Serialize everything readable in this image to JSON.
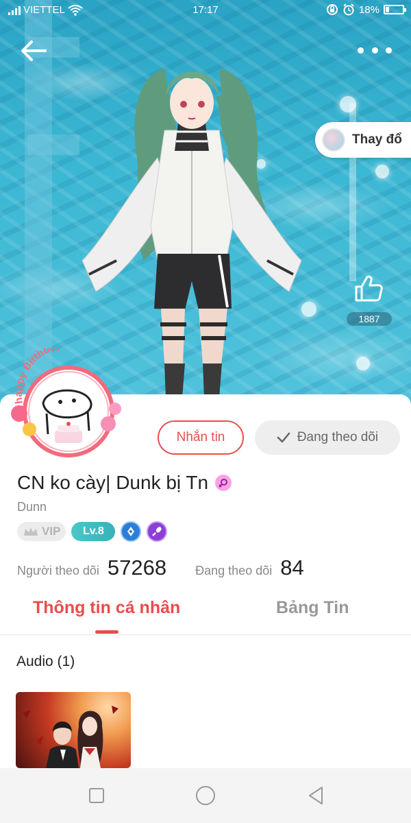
{
  "status_bar": {
    "carrier": "VIETTEL",
    "time": "17:17",
    "battery_percent": "18%",
    "battery_level": 0.18,
    "icons": [
      "signal-icon",
      "wifi-icon",
      "rotation-lock-icon",
      "alarm-icon",
      "battery-icon"
    ]
  },
  "header": {
    "back_icon": "arrow-left-icon",
    "more_icon": "more-dots-icon",
    "change_background_label": "Thay đổ",
    "like_count": "1887"
  },
  "profile": {
    "avatar_frame_text": "happy Birthday",
    "message_button": "Nhắn tin",
    "following_button": "Đang theo dõi",
    "display_name": "CN ko cày| Dunk bị Tn",
    "handle": "Dunn",
    "badges": {
      "vip": "VIP",
      "level": "Lv.8"
    },
    "stats": {
      "followers_label": "Người theo dõi",
      "followers_value": "57268",
      "following_label": "Đang theo dõi",
      "following_value": "84"
    }
  },
  "tabs": [
    {
      "label": "Thông tin cá nhân",
      "active": true
    },
    {
      "label": "Bảng Tin",
      "active": false
    }
  ],
  "content": {
    "audio_section_title": "Audio (1)"
  },
  "colors": {
    "accent": "#e84d4d",
    "level_badge": "#3fbcc0",
    "water": "#3bb7d3"
  }
}
